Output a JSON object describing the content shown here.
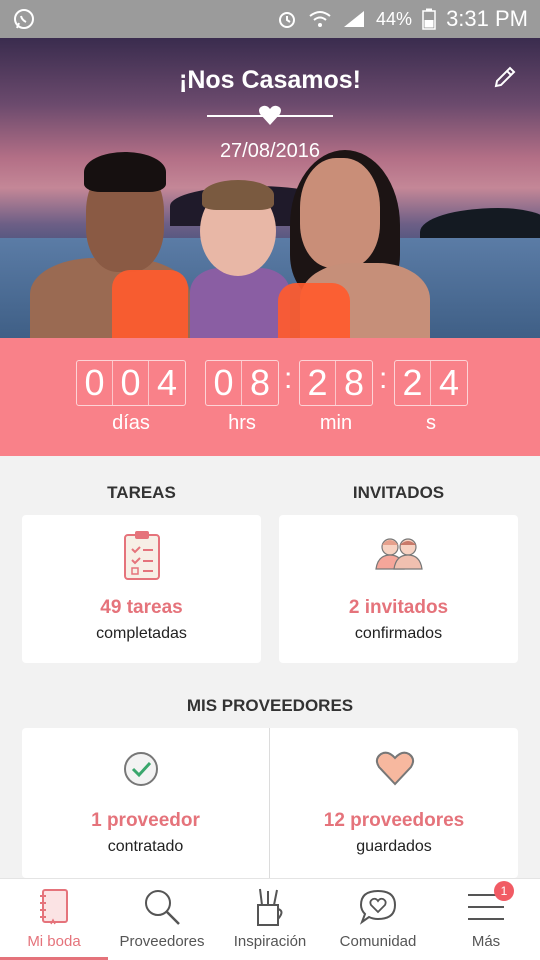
{
  "status_bar": {
    "battery": "44%",
    "time": "3:31 PM"
  },
  "hero": {
    "title": "¡Nos Casamos!",
    "date": "27/08/2016"
  },
  "countdown": {
    "days": [
      "0",
      "0",
      "4"
    ],
    "hours": [
      "0",
      "8"
    ],
    "minutes": [
      "2",
      "8"
    ],
    "seconds": [
      "2",
      "4"
    ],
    "labels": {
      "days": "días",
      "hours": "hrs",
      "minutes": "min",
      "seconds": "s"
    }
  },
  "tasks": {
    "title": "TAREAS",
    "count": "49 tareas",
    "status": "completadas"
  },
  "guests": {
    "title": "INVITADOS",
    "count": "2 invitados",
    "status": "confirmados"
  },
  "vendors": {
    "title": "MIS PROVEEDORES",
    "hired_count": "1 proveedor",
    "hired_label": "contratado",
    "saved_count": "12 proveedores",
    "saved_label": "guardados"
  },
  "nav": {
    "items": [
      {
        "label": "Mi boda",
        "icon": "notebook-icon",
        "active": true
      },
      {
        "label": "Proveedores",
        "icon": "search-icon"
      },
      {
        "label": "Inspiración",
        "icon": "pencil-cup-icon"
      },
      {
        "label": "Comunidad",
        "icon": "chat-heart-icon"
      },
      {
        "label": "Más",
        "icon": "menu-icon"
      }
    ],
    "badge": "1"
  },
  "colors": {
    "accent": "#f98189",
    "accent_text": "#e5737b"
  }
}
